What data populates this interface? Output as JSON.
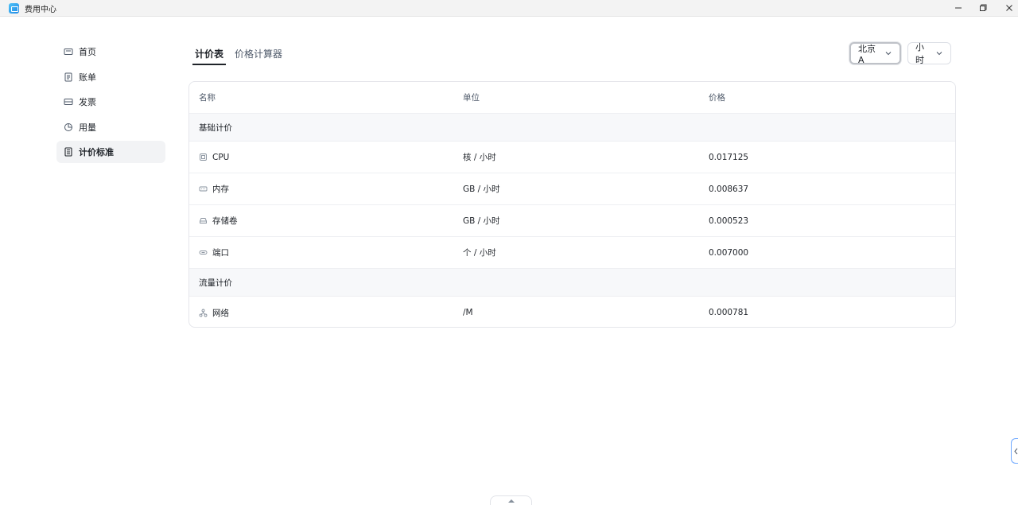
{
  "window": {
    "title": "费用中心",
    "icon": "app-icon",
    "controls": [
      "minimize-icon",
      "restore-icon",
      "close-icon"
    ]
  },
  "sidebar": {
    "items": [
      {
        "label": "首页",
        "icon": "home-icon",
        "active": false
      },
      {
        "label": "账单",
        "icon": "bill-icon",
        "active": false
      },
      {
        "label": "发票",
        "icon": "invoice-icon",
        "active": false
      },
      {
        "label": "用量",
        "icon": "usage-icon",
        "active": false
      },
      {
        "label": "计价标准",
        "icon": "pricing-icon",
        "active": true
      }
    ]
  },
  "tabs": [
    {
      "label": "计价表",
      "active": true
    },
    {
      "label": "价格计算器",
      "active": false
    }
  ],
  "filters": {
    "region": {
      "value": "北京A"
    },
    "period": {
      "value": "小时"
    }
  },
  "table": {
    "columns": [
      "名称",
      "单位",
      "价格"
    ],
    "groups": [
      {
        "title": "基础计价",
        "rows": [
          {
            "name": "CPU",
            "icon": "cpu-icon",
            "unit": "核 / 小时",
            "price": "0.017125"
          },
          {
            "name": "内存",
            "icon": "memory-icon",
            "unit": "GB / 小时",
            "price": "0.008637"
          },
          {
            "name": "存储卷",
            "icon": "storage-icon",
            "unit": "GB / 小时",
            "price": "0.000523"
          },
          {
            "name": "端口",
            "icon": "port-icon",
            "unit": "个 / 小时",
            "price": "0.007000"
          }
        ]
      },
      {
        "title": "流量计价",
        "rows": [
          {
            "name": "网络",
            "icon": "network-icon",
            "unit": "/M",
            "price": "0.000781"
          }
        ]
      }
    ]
  },
  "colors": {
    "active_nav_bg": "#f2f3f5",
    "group_row_bg": "#f7f8fa",
    "border": "#e5e6eb",
    "accent_handle": "#6ea8ff"
  }
}
